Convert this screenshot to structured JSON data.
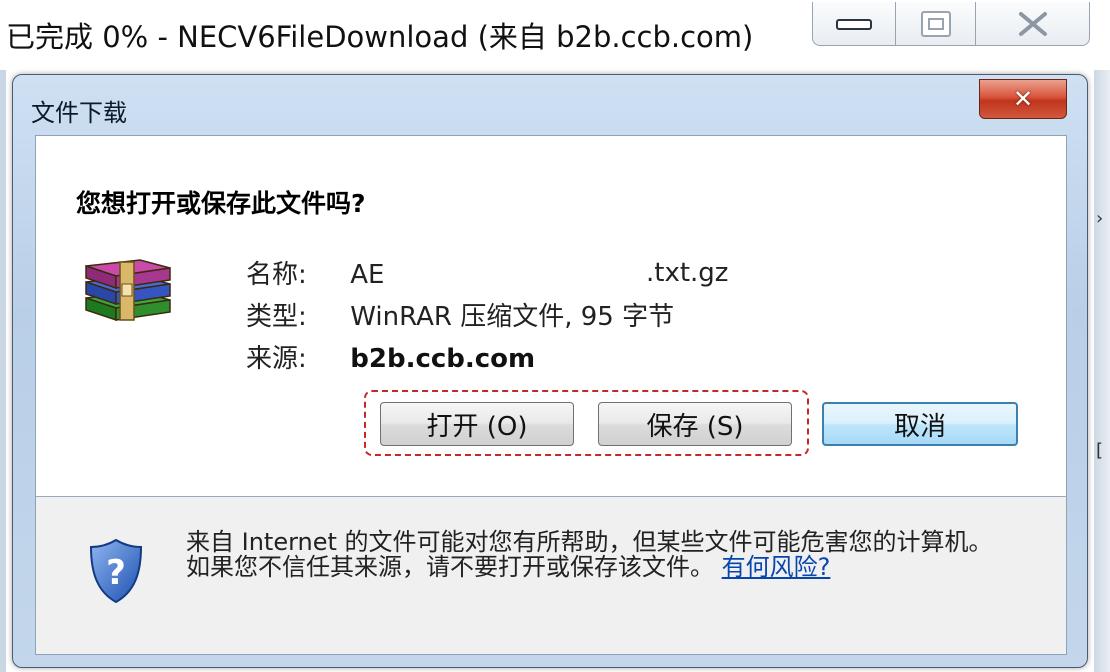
{
  "parent_window": {
    "title": "已完成 0% - NECV6FileDownload (来自 b2b.ccb.com)",
    "controls": [
      "minimize-icon",
      "maximize-icon",
      "close-icon"
    ]
  },
  "dialog": {
    "title": "文件下载",
    "close_icon": "close-icon",
    "question": "您想打开或保存此文件吗?",
    "file_icon": "winrar-archive-icon",
    "fields": [
      {
        "label": "名称:",
        "value": "AE",
        "value_suffix": ".txt.gz"
      },
      {
        "label": "类型:",
        "value": "WinRAR 压缩文件, 95 字节"
      },
      {
        "label": "来源:",
        "value": "b2b.ccb.com"
      }
    ],
    "buttons": {
      "open": "打开 (O)",
      "save": "保存 (S)",
      "cancel": "取消"
    },
    "footer": {
      "icon": "shield-question-icon",
      "text": "来自 Internet 的文件可能对您有所帮助，但某些文件可能危害您的计算机。如果您不信任其来源，请不要打开或保存该文件。",
      "link": "有何风险?"
    }
  },
  "colors": {
    "frame": "#b9cfe7",
    "close_red": "#c0341d",
    "link": "#0645ad",
    "highlight": "#c62828",
    "default_button_border": "#3c7fb1"
  }
}
